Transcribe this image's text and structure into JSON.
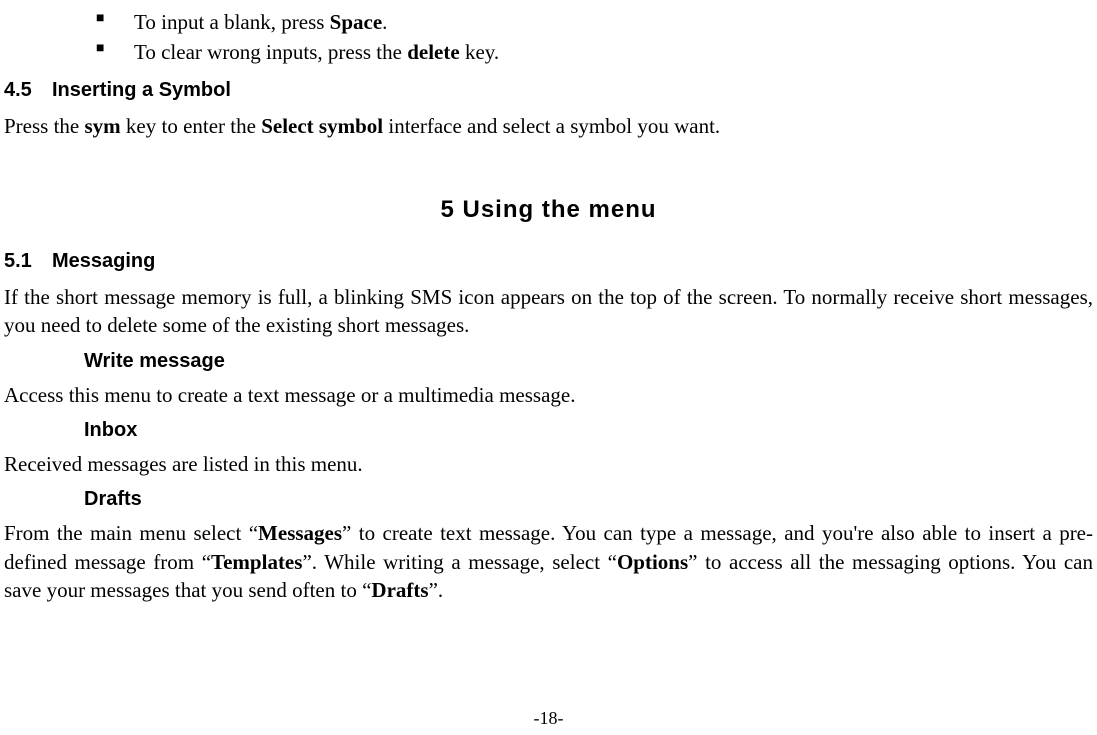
{
  "bullets": {
    "blank_prefix": "To input a blank, press ",
    "blank_bold": "Space",
    "blank_suffix": ".",
    "clear_prefix": "To clear wrong inputs, press the ",
    "clear_bold": "delete",
    "clear_suffix": " key."
  },
  "section_4_5": {
    "number": "4.5",
    "title": "Inserting a Symbol",
    "p_seg1": "Press the ",
    "p_bold1": "sym",
    "p_seg2": " key to enter the ",
    "p_bold2": "Select symbol",
    "p_seg3": " interface and select a symbol you want."
  },
  "chapter_5": {
    "title": "5  Using the menu"
  },
  "section_5_1": {
    "number": "5.1",
    "title": "Messaging",
    "intro": "If the short message memory is full, a blinking SMS icon appears on the top of the screen. To normally receive short messages, you need to delete some of the existing short messages.",
    "write_heading": "Write message",
    "write_body": "Access this menu to create a text message or a multimedia message.",
    "inbox_heading": "Inbox",
    "inbox_body": "Received messages are listed in this menu.",
    "drafts_heading": "Drafts",
    "drafts_seg1": "From the main menu select “",
    "drafts_bold1": "Messages",
    "drafts_seg2": "” to create text message. You can type a message, and you're also able to insert a pre-defined message from “",
    "drafts_bold2": "Templates",
    "drafts_seg3": "”. While writing a message, select “",
    "drafts_bold3": "Options",
    "drafts_seg4": "” to access all the messaging options. You can save your messages that you send often to “",
    "drafts_bold4": "Drafts",
    "drafts_seg5": "”."
  },
  "page_number": "-18-"
}
